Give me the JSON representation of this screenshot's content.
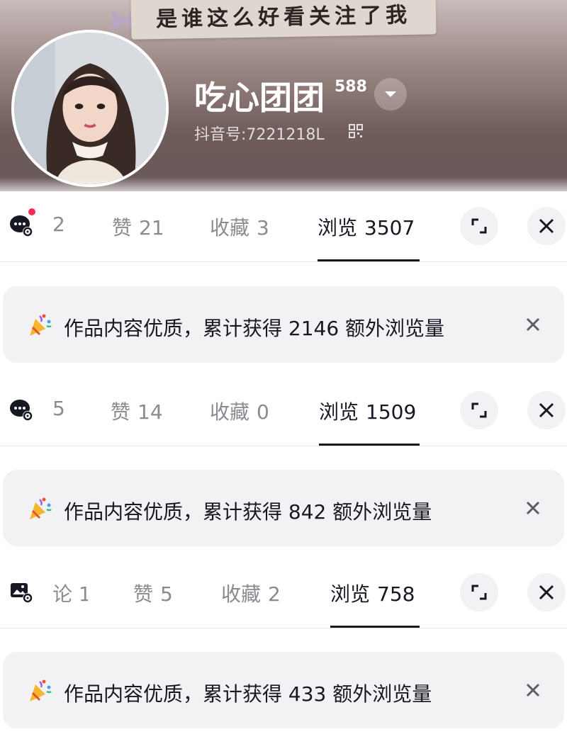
{
  "profile": {
    "banner_text": "是谁这么好看关注了我",
    "username": "吃心团团",
    "follower_count": "588",
    "douyin_id": "抖音号:7221218L"
  },
  "rows": [
    {
      "clipped_label": "2",
      "likes": {
        "label": "赞",
        "value": "21"
      },
      "favorites": {
        "label": "收藏",
        "value": "3"
      },
      "views": {
        "label": "浏览",
        "value": "3507"
      },
      "notice": {
        "text": "作品内容优质，累计获得 2146 额外浏览量"
      }
    },
    {
      "clipped_label": "5",
      "likes": {
        "label": "赞",
        "value": "14"
      },
      "favorites": {
        "label": "收藏",
        "value": "0"
      },
      "views": {
        "label": "浏览",
        "value": "1509"
      },
      "notice": {
        "text": "作品内容优质，累计获得 842 额外浏览量"
      }
    },
    {
      "clipped_label": "论 1",
      "likes": {
        "label": "赞",
        "value": "5"
      },
      "favorites": {
        "label": "收藏",
        "value": "2"
      },
      "views": {
        "label": "浏览",
        "value": "758"
      },
      "notice": {
        "text": "作品内容优质，累计获得 433 额外浏览量"
      }
    }
  ],
  "icons": {
    "dropdown": "chevron-down-icon",
    "qr": "qr-code-icon",
    "row_icon": "comment-settings-icon",
    "expand": "expand-icon",
    "close": "close-icon",
    "party": "party-popper-icon"
  },
  "colors": {
    "accent": "#fe2c55",
    "text_primary": "#161823",
    "text_secondary": "#8a8b91",
    "card_bg": "#f2f2f4"
  }
}
